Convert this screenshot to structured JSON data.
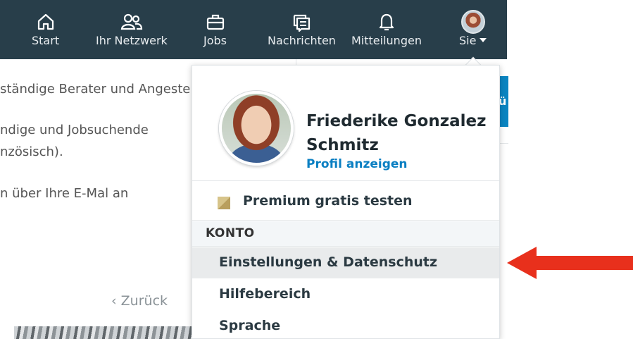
{
  "nav": {
    "items": [
      {
        "label": "Start"
      },
      {
        "label": "Ihr Netzwerk"
      },
      {
        "label": "Jobs"
      },
      {
        "label": "Nachrichten"
      },
      {
        "label": "Mitteilungen"
      },
      {
        "label": "Sie"
      }
    ]
  },
  "background": {
    "line1": "ständige Berater und Angeste",
    "line2": "ndige und Jobsuchende",
    "line3": "nzösisch).",
    "line4": "n über Ihre E-Mal an",
    "back": "Zurück",
    "back_icon": "‹",
    "button_fragment": "ü"
  },
  "dropdown": {
    "profile": {
      "name": "Friederike Gonzalez Schmitz",
      "link": "Profil anzeigen"
    },
    "premium": "Premium gratis testen",
    "section_header": "KONTO",
    "items": [
      {
        "label": "Einstellungen & Datenschutz"
      },
      {
        "label": "Hilfebereich"
      },
      {
        "label": "Sprache"
      }
    ]
  },
  "colors": {
    "nav_bg": "#283e4a",
    "link_blue": "#0a7fc2",
    "arrow_red": "#e8301c",
    "highlight": "#e9ebec"
  }
}
